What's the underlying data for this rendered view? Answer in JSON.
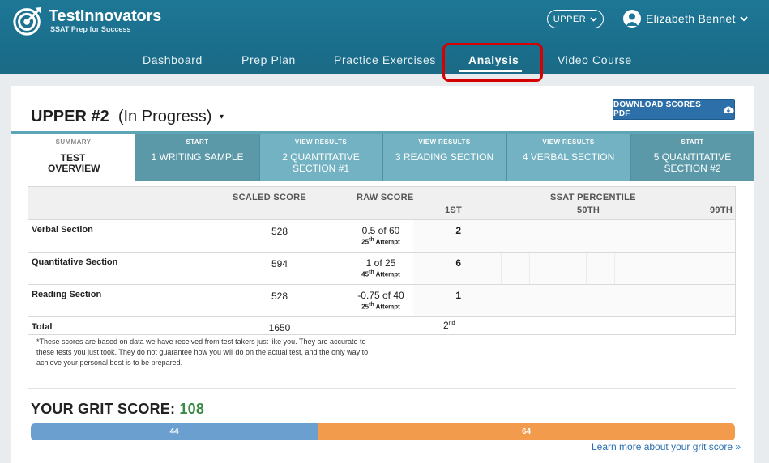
{
  "brand": {
    "title": "TestInnovators",
    "subtitle": "SSAT Prep for Success"
  },
  "level": {
    "label": "UPPER"
  },
  "user": {
    "name": "Elizabeth Bennet"
  },
  "nav": [
    "Dashboard",
    "Prep Plan",
    "Practice Exercises",
    "Analysis",
    "Video Course"
  ],
  "nav_active": "Analysis",
  "test": {
    "name": "UPPER #2",
    "status": "(In Progress)"
  },
  "download_label": "DOWNLOAD SCORES PDF",
  "tabs": [
    {
      "small": "SUMMARY",
      "label": "TEST OVERVIEW",
      "kind": "summary"
    },
    {
      "small": "START",
      "label": "1 WRITING SAMPLE",
      "kind": "start"
    },
    {
      "small": "VIEW RESULTS",
      "label": "2 QUANTITATIVE SECTION #1",
      "kind": "view"
    },
    {
      "small": "VIEW RESULTS",
      "label": "3 READING SECTION",
      "kind": "view"
    },
    {
      "small": "VIEW RESULTS",
      "label": "4 VERBAL SECTION",
      "kind": "view"
    },
    {
      "small": "START",
      "label": "5 QUANTITATIVE SECTION #2",
      "kind": "start"
    }
  ],
  "table": {
    "headers": {
      "scaled": "SCALED SCORE",
      "raw": "RAW SCORE",
      "percentile": "SSAT PERCENTILE",
      "p1": "1ST",
      "p50": "50TH",
      "p99": "99TH"
    },
    "rows": [
      {
        "label": "Verbal Section",
        "scaled": "528",
        "raw": "0.5 of 60",
        "attempt_num": "25",
        "attempt_sup": "th",
        "attempt_word": "Attempt",
        "percentile": "2"
      },
      {
        "label": "Quantitative Section",
        "scaled": "594",
        "raw": "1 of 25",
        "attempt_num": "45",
        "attempt_sup": "th",
        "attempt_word": "Attempt",
        "percentile": "6"
      },
      {
        "label": "Reading Section",
        "scaled": "528",
        "raw": "-0.75 of 40",
        "attempt_num": "25",
        "attempt_sup": "th",
        "attempt_word": "Attempt",
        "percentile": "1"
      }
    ],
    "total": {
      "label": "Total",
      "scaled": "1650",
      "percentile_num": "2",
      "percentile_sup": "nd"
    }
  },
  "footnote": "*These scores are based on data we have received from test takers just like you. They are accurate to these tests you just took. They do not guarantee how you will do on the actual test, and the only way to achieve your personal best is to be prepared.",
  "grit": {
    "title": "YOUR GRIT SCORE:",
    "score": "108",
    "segments": [
      {
        "value": 44,
        "label": "44",
        "color": "#6b9fcf"
      },
      {
        "value": 64,
        "label": "64",
        "color": "#f39b4c"
      }
    ],
    "link": "Learn more about your grit score »"
  },
  "colors": {
    "header": "#1e7796",
    "accent": "#2d6fa8",
    "tab_start": "#5b98a8",
    "tab_view": "#72b2c2",
    "highlight": "#d50000"
  }
}
